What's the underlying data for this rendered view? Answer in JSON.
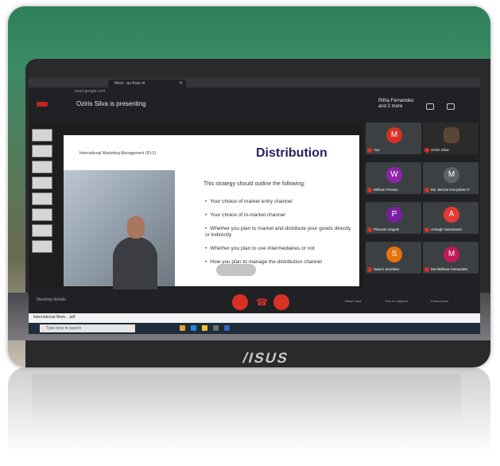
{
  "browser": {
    "tab_title": "Meet - qu-feas-rit",
    "address": "meet.google.com"
  },
  "meeting": {
    "presenting_text": "Oziris Silva is presenting",
    "participants_header": "Ritha Fernandes\nand 2 more",
    "meeting_details": "Meeting details"
  },
  "slide": {
    "header": "International Marketing Management (IO-3)",
    "title": "Distribution",
    "intro": "This strategy should outline the following:",
    "bullets": [
      "Your choice of market entry channel",
      "Your choice of in-market channel",
      "Whether you plan to market and distribute your goods directly or indirectly",
      "Whether you plan to use intermediaries or not",
      "How you plan to manage the distribution channel"
    ]
  },
  "participants": [
    {
      "initial": "M",
      "name": "You",
      "color": "#d93025"
    },
    {
      "initial": "",
      "name": "Oziris Silva",
      "color": "#3c4043"
    },
    {
      "initial": "W",
      "name": "William Ferraro",
      "color": "#8e24aa"
    },
    {
      "initial": "M",
      "name": "Ms. Mercia Gonçalves F.",
      "color": "#5f6368"
    },
    {
      "initial": "P",
      "name": "Pheonie Gagele",
      "color": "#7b1fa2"
    },
    {
      "initial": "A",
      "name": "Armagh Sarvanand",
      "color": "#e53935"
    },
    {
      "initial": "S",
      "name": "Saturn Zenefaer",
      "color": "#e8710a"
    },
    {
      "initial": "M",
      "name": "Ms Mellissa Fernandes",
      "color": "#c2185b"
    }
  ],
  "right_buttons": [
    "Raise hand",
    "Turn on captions",
    "Present now"
  ],
  "download": {
    "filename": "International Mark....pdf"
  },
  "taskbar": {
    "search_placeholder": "Type here to search"
  },
  "brand": {
    "laptop_logo": "/ISUS"
  }
}
